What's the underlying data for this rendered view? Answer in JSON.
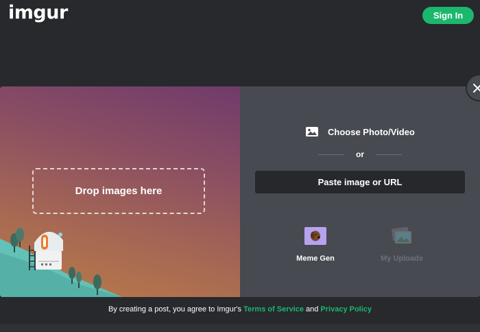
{
  "header": {
    "logo_text": "imgur",
    "signin_label": "Sign In"
  },
  "upload": {
    "drop_label": "Drop images here",
    "choose_label": "Choose Photo/Video",
    "or_label": "or",
    "paste_label": "Paste image or URL",
    "meme_gen_label": "Meme Gen",
    "my_uploads_label": "My Uploads"
  },
  "footer": {
    "prefix": "By creating a post, you agree to Imgur's ",
    "terms_label": "Terms of Service",
    "and_text": " and ",
    "privacy_label": "Privacy Policy"
  },
  "icons": {
    "close": "close-icon",
    "choose": "image-icon",
    "meme": "meme-gen-icon",
    "uploads": "my-uploads-icon"
  },
  "colors": {
    "background": "#27292d",
    "accent_green": "#1bb76e",
    "panel": "#474a51",
    "input": "#26282c"
  }
}
